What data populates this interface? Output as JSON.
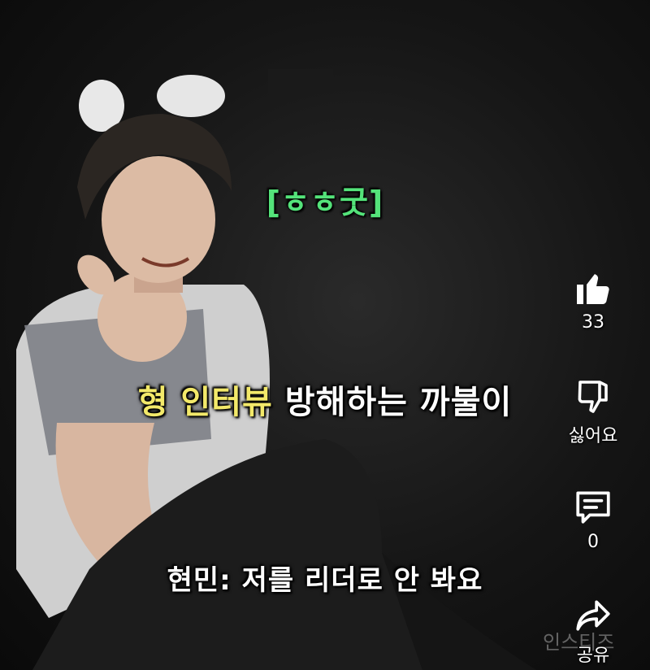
{
  "video": {
    "tag_caption": "[ㅎㅎ굿]",
    "subtitle_line1_highlight": "형 인터뷰",
    "subtitle_line1_rest": " 방해하는 까불이",
    "subtitle_line2": "현민: 저를 리더로 안 봐요",
    "watermark": "인스티즈"
  },
  "actions": {
    "like": {
      "icon": "thumbs-up-icon",
      "count": "33"
    },
    "dislike": {
      "icon": "thumbs-down-icon",
      "label": "싫어요"
    },
    "comment": {
      "icon": "comment-icon",
      "count": "0"
    },
    "share": {
      "icon": "share-icon",
      "label": "공유"
    }
  },
  "colors": {
    "tag_green": "#54e37a",
    "subtitle_highlight": "#f3e96a",
    "subtitle_white": "#ffffff"
  }
}
